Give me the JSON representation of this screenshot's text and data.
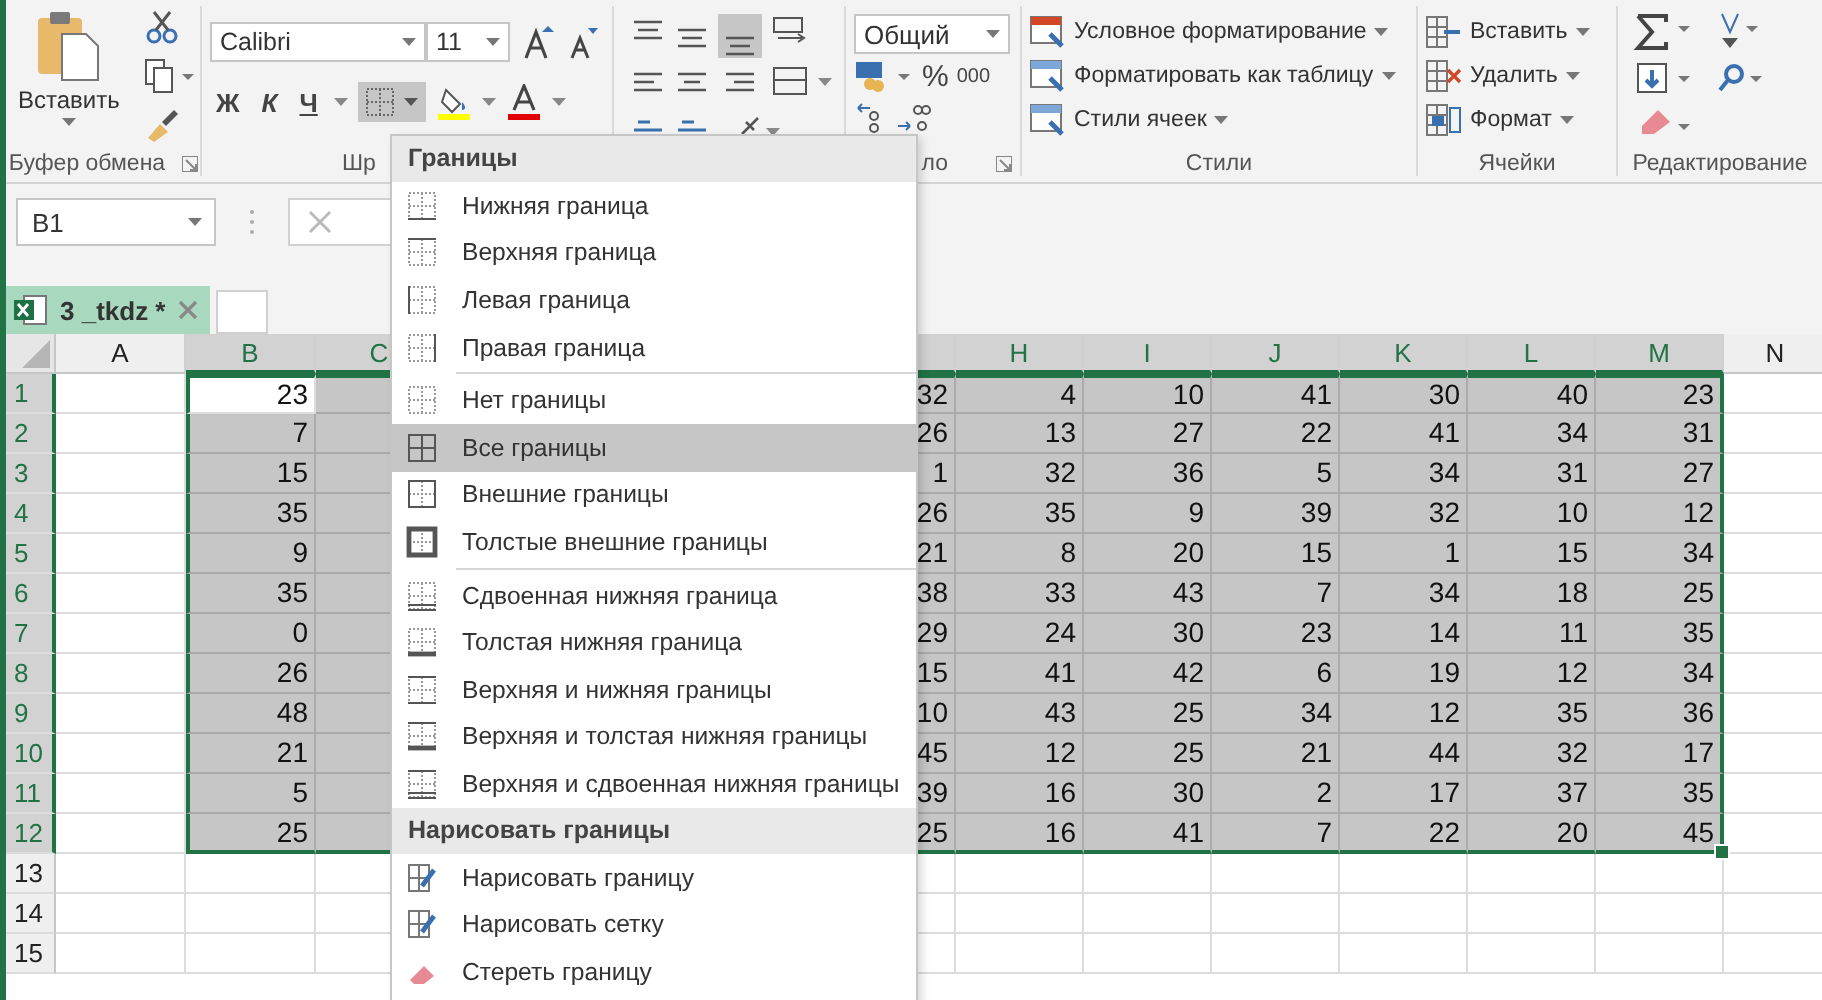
{
  "ribbon": {
    "clipboard": {
      "paste_label": "Вставить",
      "group_label": "Буфер обмена"
    },
    "font": {
      "font_name": "Calibri",
      "font_size": "11",
      "bold_label": "Ж",
      "italic_label": "К",
      "underline_label": "Ч",
      "borders_pressed": true,
      "group_label": "Шр"
    },
    "number": {
      "format": "Общий",
      "percent_label": "%",
      "thousands_label": "000",
      "group_label": "ло"
    },
    "styles": {
      "buttons": [
        "Условное форматирование",
        "Форматировать как таблицу",
        "Стили ячеек"
      ],
      "group_label": "Стили"
    },
    "cells": {
      "buttons": [
        "Вставить",
        "Удалить",
        "Формат"
      ],
      "group_label": "Ячейки"
    },
    "editing": {
      "group_label": "Редактирование"
    }
  },
  "formula_bar": {
    "name_box": "B1"
  },
  "sheet_tabs": [
    {
      "label": "3 _tkdz *",
      "selected": true
    }
  ],
  "grid": {
    "columns": [
      {
        "label": "A",
        "selected": false
      },
      {
        "label": "B",
        "selected": true
      },
      {
        "label": "C",
        "selected": true
      },
      {
        "label": "H",
        "selected": true
      },
      {
        "label": "I",
        "selected": true
      },
      {
        "label": "J",
        "selected": true
      },
      {
        "label": "K",
        "selected": true
      },
      {
        "label": "L",
        "selected": true
      },
      {
        "label": "M",
        "selected": true
      },
      {
        "label": "N",
        "selected": false
      }
    ],
    "rows": [
      {
        "label": "1",
        "selected": true,
        "values": [
          "23",
          "32",
          "4",
          "10",
          "41",
          "30",
          "40",
          "23"
        ]
      },
      {
        "label": "2",
        "selected": true,
        "values": [
          "7",
          "26",
          "13",
          "27",
          "22",
          "41",
          "34",
          "31"
        ]
      },
      {
        "label": "3",
        "selected": true,
        "values": [
          "15",
          "1",
          "32",
          "36",
          "5",
          "34",
          "31",
          "27"
        ]
      },
      {
        "label": "4",
        "selected": true,
        "values": [
          "35",
          "26",
          "35",
          "9",
          "39",
          "32",
          "10",
          "12"
        ]
      },
      {
        "label": "5",
        "selected": true,
        "values": [
          "9",
          "21",
          "8",
          "20",
          "15",
          "1",
          "15",
          "34"
        ]
      },
      {
        "label": "6",
        "selected": true,
        "values": [
          "35",
          "38",
          "33",
          "43",
          "7",
          "34",
          "18",
          "25"
        ]
      },
      {
        "label": "7",
        "selected": true,
        "values": [
          "0",
          "29",
          "24",
          "30",
          "23",
          "14",
          "11",
          "35"
        ]
      },
      {
        "label": "8",
        "selected": true,
        "values": [
          "26",
          "15",
          "41",
          "42",
          "6",
          "19",
          "12",
          "34"
        ]
      },
      {
        "label": "9",
        "selected": true,
        "values": [
          "48",
          "10",
          "43",
          "25",
          "34",
          "12",
          "35",
          "36"
        ]
      },
      {
        "label": "10",
        "selected": true,
        "values": [
          "21",
          "45",
          "12",
          "25",
          "21",
          "44",
          "32",
          "17"
        ]
      },
      {
        "label": "11",
        "selected": true,
        "values": [
          "5",
          "39",
          "16",
          "30",
          "2",
          "17",
          "37",
          "35"
        ]
      },
      {
        "label": "12",
        "selected": true,
        "values": [
          "25",
          "25",
          "16",
          "41",
          "7",
          "22",
          "20",
          "45"
        ]
      },
      {
        "label": "13",
        "selected": false
      },
      {
        "label": "14",
        "selected": false
      },
      {
        "label": "15",
        "selected": false
      }
    ]
  },
  "borders_menu": {
    "items": [
      {
        "kind": "header",
        "label": "Границы"
      },
      {
        "kind": "item",
        "label": "Нижняя граница",
        "selected": false
      },
      {
        "kind": "item",
        "label": "Верхняя граница",
        "selected": false
      },
      {
        "kind": "item",
        "label": "Левая граница",
        "selected": false
      },
      {
        "kind": "item",
        "label": "Правая граница",
        "selected": false
      },
      {
        "kind": "separator"
      },
      {
        "kind": "item",
        "label": "Нет границы",
        "selected": false
      },
      {
        "kind": "item",
        "label": "Все границы",
        "selected": true
      },
      {
        "kind": "item",
        "label": "Внешние границы",
        "selected": false
      },
      {
        "kind": "item",
        "label": "Толстые внешние границы",
        "selected": false
      },
      {
        "kind": "separator"
      },
      {
        "kind": "item",
        "label": "Сдвоенная нижняя граница",
        "selected": false
      },
      {
        "kind": "item",
        "label": "Толстая нижняя граница",
        "selected": false
      },
      {
        "kind": "item",
        "label": "Верхняя и нижняя границы",
        "selected": false
      },
      {
        "kind": "item",
        "label": "Верхняя и толстая нижняя границы",
        "selected": false
      },
      {
        "kind": "item",
        "label": "Верхняя и сдвоенная нижняя границы",
        "selected": false
      },
      {
        "kind": "header",
        "label": "Нарисовать границы"
      },
      {
        "kind": "item",
        "label": "Нарисовать границу",
        "selected": false
      },
      {
        "kind": "item",
        "label": "Нарисовать сетку",
        "selected": false
      },
      {
        "kind": "item",
        "label": "Стереть границу",
        "selected": false
      }
    ]
  }
}
